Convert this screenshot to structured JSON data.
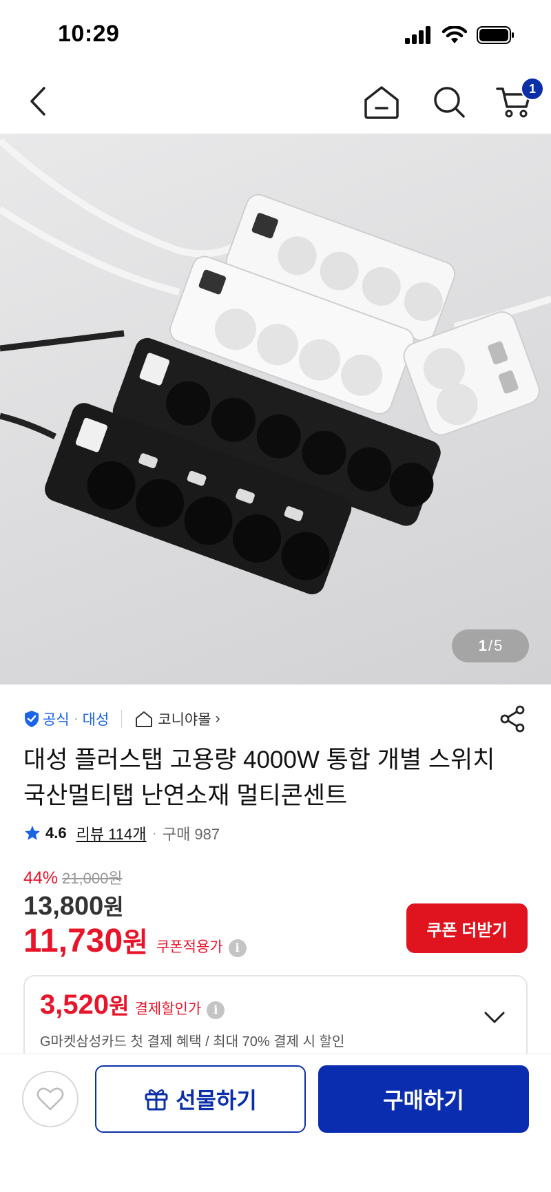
{
  "status_bar": {
    "time": "10:29"
  },
  "nav": {
    "cart_count": "1"
  },
  "gallery": {
    "current": "1",
    "separator": "/",
    "total": "5"
  },
  "store": {
    "official_label": "공식",
    "separator": "·",
    "brand": "대성",
    "shop_name": "코니야몰",
    "shop_chevron": "›"
  },
  "product": {
    "title": "대성 플러스탭 고용량 4000W 통합 개별 스위치 국산멀티탭 난연소재 멀티콘센트",
    "rating": "4.6",
    "reviews": "리뷰 114개",
    "separator": "·",
    "purchases": "구매 987"
  },
  "price": {
    "discount_pct": "44%",
    "original": "21,000원",
    "sale_num": "13,800",
    "sale_unit": "원",
    "coupon_num": "11,730",
    "coupon_unit": "원",
    "coupon_note": "쿠폰적용가",
    "info_glyph": "i"
  },
  "coupon_button": "쿠폰 더받기",
  "card_promo": {
    "amount_num": "3,520",
    "amount_unit": "원",
    "amount_note": "결제할인가",
    "info_glyph": "i",
    "description": "G마켓삼성카드 첫 결제 혜택 / 최대 70% 결제 시 할인"
  },
  "bottom_bar": {
    "gift_label": "선물하기",
    "buy_label": "구매하기"
  },
  "colors": {
    "brand_blue": "#0b2fa8",
    "link_blue": "#1a64e8",
    "price_red": "#e8142a",
    "coupon_red": "#e0141f"
  },
  "icons": [
    "back-icon",
    "home-icon",
    "search-icon",
    "cart-icon",
    "shield-check-icon",
    "store-home-icon",
    "share-icon",
    "star-icon",
    "info-icon",
    "chevron-down-icon",
    "heart-icon",
    "gift-icon"
  ]
}
